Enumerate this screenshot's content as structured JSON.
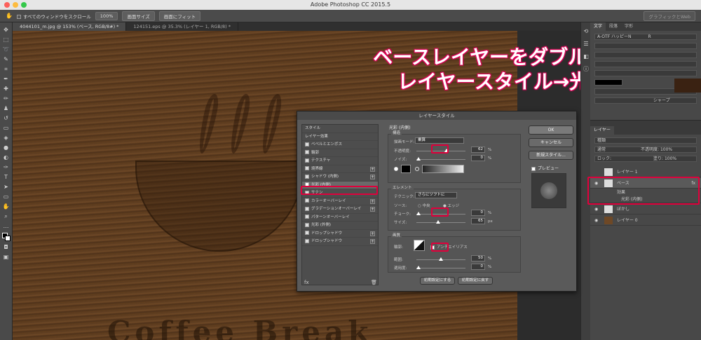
{
  "window": {
    "title": "Adobe Photoshop CC 2015.5"
  },
  "options_bar": {
    "scroll_all": "すべてのウィンドウをスクロール",
    "zoom": "100%",
    "fit_screen": "画面サイズ",
    "fill_screen": "画面にフィット",
    "workspace": "グラフィックとWeb"
  },
  "doc_tabs": [
    "4044101_m.jpg @ 153% (ベース, RGB/8#) *",
    "124151.eps @ 35.3% (レイヤー 1, RGB/8) *"
  ],
  "canvas": {
    "headline_1": "ベースレイヤーをダブルクリック",
    "headline_2": "レイヤースタイル→光彩(内側)",
    "logo_text": "Coffee Break"
  },
  "char_panel": {
    "tabs": [
      "文字",
      "段落",
      "字形"
    ],
    "font": "A-OTF ハッピーN",
    "style": "R",
    "aa": "シャープ"
  },
  "layers_panel": {
    "title": "レイヤー",
    "kind": "種類",
    "mode": "通常",
    "opacity": "不透明度: 100%",
    "lock": "ロック:",
    "fill": "塗り: 100%",
    "layers": [
      {
        "name": "レイヤー 1"
      },
      {
        "name": "ベース",
        "fx": "fx"
      },
      {
        "name": "効果"
      },
      {
        "name": "光彩 (内側)"
      },
      {
        "name": "ぼかし"
      },
      {
        "name": "レイヤー 0"
      }
    ]
  },
  "dialog": {
    "title": "レイヤースタイル",
    "left_items": [
      {
        "label": "スタイル",
        "checkbox": false,
        "plus": false
      },
      {
        "label": "レイヤー効果",
        "checkbox": false,
        "plus": false
      },
      {
        "label": "ベベルとエンボス",
        "checkbox": true,
        "plus": false
      },
      {
        "label": "輪郭",
        "checkbox": true,
        "plus": false
      },
      {
        "label": "テクスチャ",
        "checkbox": true,
        "plus": false
      },
      {
        "label": "境界線",
        "checkbox": true,
        "plus": true
      },
      {
        "label": "シャドウ (内側)",
        "checkbox": true,
        "plus": true
      },
      {
        "label": "光彩 (内側)",
        "checkbox": true,
        "plus": false,
        "checked": true
      },
      {
        "label": "サテン",
        "checkbox": true,
        "plus": false
      },
      {
        "label": "カラーオーバーレイ",
        "checkbox": true,
        "plus": true
      },
      {
        "label": "グラデーションオーバーレイ",
        "checkbox": true,
        "plus": true
      },
      {
        "label": "パターンオーバーレイ",
        "checkbox": true,
        "plus": false
      },
      {
        "label": "光彩 (外側)",
        "checkbox": true,
        "plus": false
      },
      {
        "label": "ドロップシャドウ",
        "checkbox": true,
        "plus": true
      },
      {
        "label": "ドロップシャドウ",
        "checkbox": true,
        "plus": true
      }
    ],
    "panel_title": "光彩 (内側)",
    "structure": {
      "title": "構造",
      "blend_label": "描画モード:",
      "blend_value": "乗算",
      "opacity_label": "不透明度:",
      "opacity_value": "62",
      "noise_label": "ノイズ:",
      "noise_value": "0",
      "unit": "%"
    },
    "elements": {
      "title": "エレメント",
      "technique_label": "テクニック:",
      "technique_value": "さらにソフトに",
      "source_label": "ソース:",
      "center": "中央",
      "edge": "エッジ",
      "choke_label": "チョーク:",
      "choke_value": "0",
      "size_label": "サイズ:",
      "size_value": "65",
      "px": "px"
    },
    "quality": {
      "title": "画質",
      "contour_label": "輪郭:",
      "antialias": "アンチエイリアス",
      "range_label": "範囲:",
      "range_value": "50",
      "jitter_label": "適用度:",
      "jitter_value": "0",
      "unit": "%"
    },
    "buttons": {
      "ok": "OK",
      "cancel": "キャンセル",
      "new_style": "新規スタイル...",
      "preview": "プレビュー",
      "make_default": "初期設定にする",
      "reset_default": "初期設定に戻す"
    },
    "footer": "fx"
  },
  "colors": {
    "highlight": "#e0003c",
    "wood": "#6e4826"
  }
}
